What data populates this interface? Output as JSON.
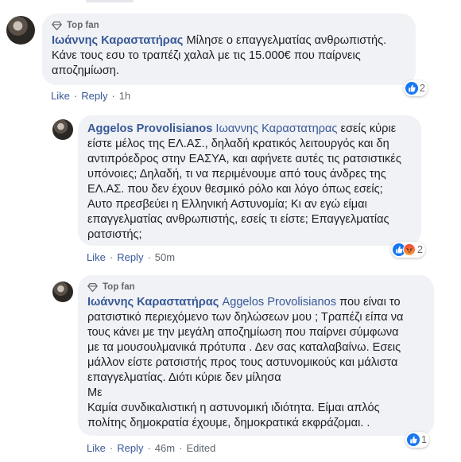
{
  "colors": {
    "link": "#385898",
    "bubble": "#f0f2f5",
    "like_blue": "#1877f2"
  },
  "comments": [
    {
      "badge": "Top fan",
      "author": "Ιωάννης Καραστατήρας",
      "mention": "",
      "lines": [
        "Μίλησε ο επαγγελματίας ανθρωπιστής.",
        "Κάνε τους εσυ το τραπέζι χαλαλ με τις 15.000€ που παίρνεις",
        "αποζημίωση."
      ],
      "actions": {
        "like": "Like",
        "reply": "Reply",
        "time": "1h",
        "edited": ""
      },
      "reaction_count": "2",
      "reaction_icons": [
        "like-icon"
      ]
    },
    {
      "badge": "",
      "author": "Aggelos Provolisianos",
      "mention": "Ιωαννης Καραστατηρας",
      "lines": [
        " εσείς κύριε",
        "είστε μέλος της ΕΛ.ΑΣ., δηλαδή κρατικός λειτουργός και δη",
        "αντιπρόεδρος στην ΕΑΣΥΑ, και αφήνετε αυτές τις ρατσιστικές",
        "υπόνοιες; Δηλαδή, τι να περιμένουμε από τους άνδρες της",
        "ΕΛ.ΑΣ. που δεν έχουν θεσμικό ρόλο και λόγο όπως εσείς;",
        "Αυτο πρεσβεύει η Ελληνική Αστυνομία; Κι αν εγώ είμαι",
        "επαγγελματίας ανθρωπιστής, εσείς τι είστε; Επαγγελματίας",
        "ρατσιστής;"
      ],
      "actions": {
        "like": "Like",
        "reply": "Reply",
        "time": "50m",
        "edited": ""
      },
      "reaction_count": "2",
      "reaction_icons": [
        "like-icon",
        "angry-icon"
      ]
    },
    {
      "badge": "Top fan",
      "author": "Ιωάννης Καραστατήρας",
      "mention": "Aggelos Provolisianos",
      "lines": [
        " που είναι το",
        "ρατσιστικό περιεχόμενο των δηλώσεων μου ; Τραπέζι είπα να",
        "τους κάνει με την μεγάλη αποζημίωση που παίρνει σύμφωνα",
        "με τα μουσουλμανικά πρότυπα . Δεν σας καταλαβαίνω. Εσεις",
        "μάλλον είστε ρατσιστής προς τους αστυνομικούς και μάλιστα",
        "επαγγελματίας. Διότι κύριε δεν μίλησα",
        "Με",
        "Καμία συνδικαλιστική η αστυνομική ιδιότητα. Είμαι απλός",
        "πολίτης δημοκρατία έχουμε, δημοκρατικά εκφράζομαι. ."
      ],
      "actions": {
        "like": "Like",
        "reply": "Reply",
        "time": "46m",
        "edited": "Edited"
      },
      "reaction_count": "1",
      "reaction_icons": [
        "like-icon"
      ]
    }
  ]
}
